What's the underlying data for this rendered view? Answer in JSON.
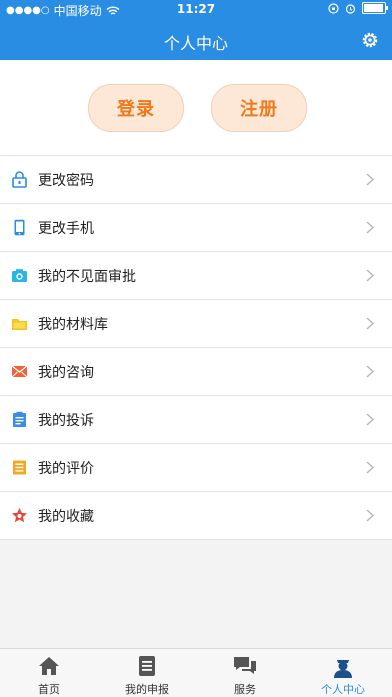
{
  "status_bar": {
    "carrier": "中国移动",
    "time": "11:27"
  },
  "header": {
    "title": "个人中心"
  },
  "auth": {
    "login_label": "登录",
    "register_label": "注册"
  },
  "menu": [
    {
      "label": "更改密码",
      "icon": "lock-icon"
    },
    {
      "label": "更改手机",
      "icon": "phone-icon"
    },
    {
      "label": "我的不见面审批",
      "icon": "camera-icon"
    },
    {
      "label": "我的材料库",
      "icon": "folder-icon"
    },
    {
      "label": "我的咨询",
      "icon": "mail-icon"
    },
    {
      "label": "我的投诉",
      "icon": "clipboard-icon"
    },
    {
      "label": "我的评价",
      "icon": "list-icon"
    },
    {
      "label": "我的收藏",
      "icon": "star-icon"
    }
  ],
  "tabbar": [
    {
      "label": "首页",
      "icon": "home-icon"
    },
    {
      "label": "我的申报",
      "icon": "document-icon"
    },
    {
      "label": "服务",
      "icon": "chat-icon"
    },
    {
      "label": "个人中心",
      "icon": "user-icon",
      "active": true
    }
  ],
  "colors": {
    "brand": "#2a8de4",
    "accent": "#ef7a1a"
  }
}
